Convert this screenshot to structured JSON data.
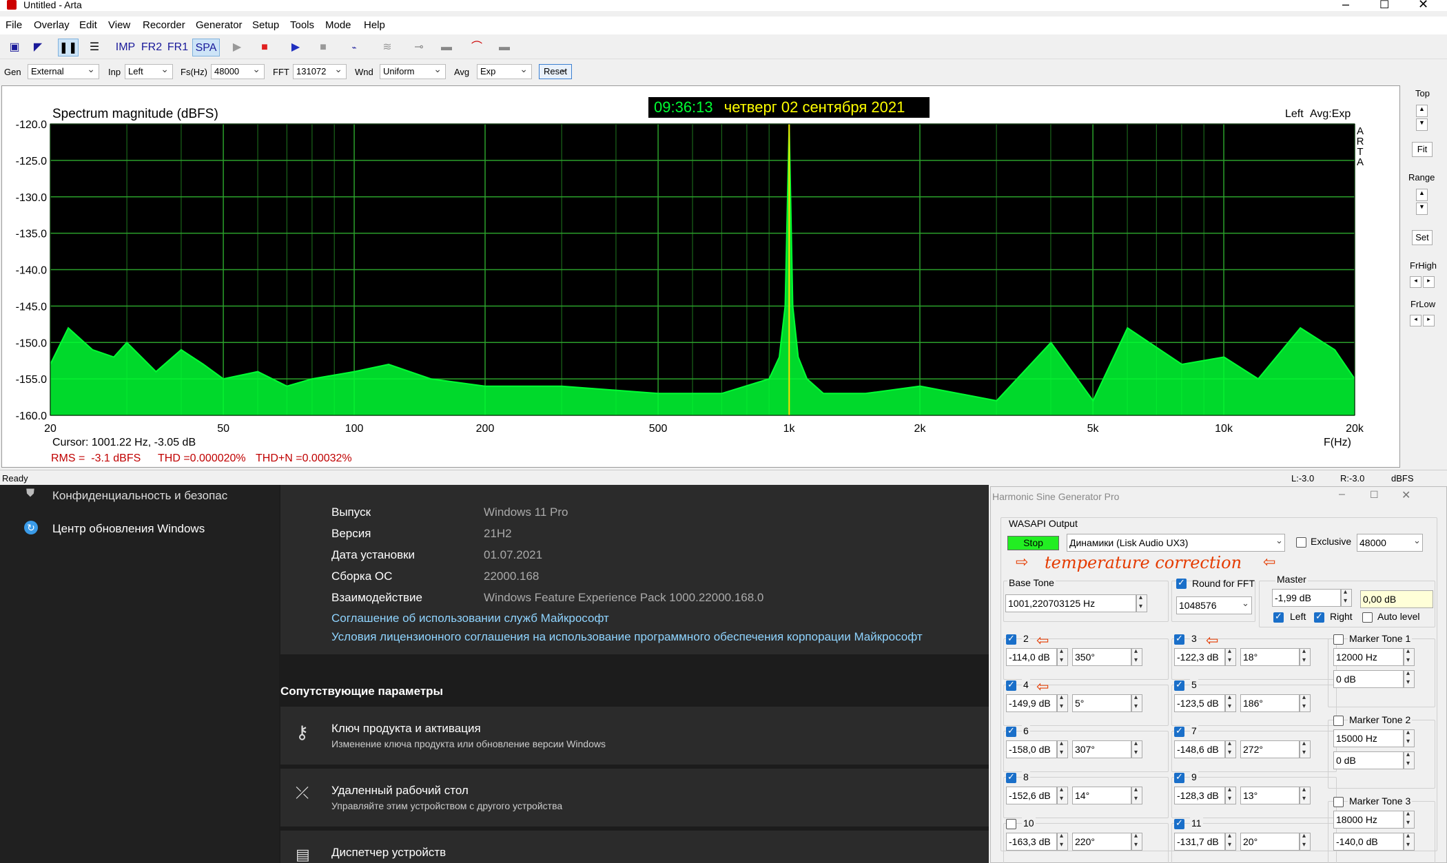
{
  "arta": {
    "title": "Untitled - Arta",
    "menu": [
      "File",
      "Overlay",
      "Edit",
      "View",
      "Recorder",
      "Generator",
      "Setup",
      "Tools",
      "Mode",
      "Help"
    ],
    "toolbar": {
      "imp": "IMP",
      "fr2": "FR2",
      "fr1": "FR1",
      "spa": "SPA"
    },
    "options": {
      "gen_label": "Gen",
      "gen_value": "External",
      "inp_label": "Inp",
      "inp_value": "Left",
      "fs_label": "Fs(Hz)",
      "fs_value": "48000",
      "fft_label": "FFT",
      "fft_value": "131072",
      "wnd_label": "Wnd",
      "wnd_value": "Uniform",
      "avg_label": "Avg",
      "avg_value": "Exp",
      "reset": "Reset"
    },
    "plot": {
      "time": "09:36:13",
      "date": "четверг 02 сентября 2021",
      "channel": "Left",
      "avg": "Avg:Exp",
      "arta_vertical": [
        "A",
        "R",
        "T",
        "A"
      ],
      "cursor": "Cursor: 1001.22 Hz, -3.05 dB",
      "rms": "RMS =  -3.1 dBFS",
      "thd": "THD =0.000020%",
      "thdn": "THD+N =0.00032%"
    },
    "right_panel": {
      "top": "Top",
      "fit": "Fit",
      "range": "Range",
      "set": "Set",
      "frhigh": "FrHigh",
      "frlow": "FrLow"
    },
    "status": {
      "ready": "Ready",
      "l": "L:-3.0",
      "r": "R:-3.0",
      "dbfs": "dBFS"
    }
  },
  "chart_data": {
    "type": "line",
    "title": "Spectrum magnitude (dBFS)",
    "xlabel": "F(Hz)",
    "ylabel": "",
    "x_scale": "log",
    "xlim": [
      20,
      20000
    ],
    "ylim": [
      -160,
      -120
    ],
    "x_ticks": [
      "20",
      "50",
      "100",
      "200",
      "500",
      "1k",
      "2k",
      "5k",
      "10k",
      "20k"
    ],
    "x_tick_values": [
      20,
      50,
      100,
      200,
      500,
      1000,
      2000,
      5000,
      10000,
      20000
    ],
    "y_ticks": [
      "-120.0",
      "-125.0",
      "-130.0",
      "-135.0",
      "-140.0",
      "-145.0",
      "-150.0",
      "-155.0",
      "-160.0"
    ],
    "y_tick_values": [
      -120,
      -125,
      -130,
      -135,
      -140,
      -145,
      -150,
      -155,
      -160
    ],
    "grid": true,
    "series": [
      {
        "color": "#00ff33",
        "x": [
          20,
          22,
          25,
          28,
          30,
          35,
          40,
          45,
          50,
          60,
          70,
          80,
          100,
          120,
          150,
          200,
          300,
          500,
          700,
          900,
          950,
          980,
          1001,
          1020,
          1050,
          1100,
          1200,
          1500,
          2002,
          3003,
          4004,
          5005,
          6006,
          8008,
          10010,
          12000,
          15000,
          18000,
          20000
        ],
        "y": [
          -153,
          -148,
          -151,
          -152,
          -150,
          -154,
          -151,
          -153,
          -155,
          -154,
          -156,
          -155,
          -154,
          -153,
          -155,
          -156,
          -156,
          -157,
          -157,
          -155,
          -152,
          -145,
          -3,
          -145,
          -152,
          -155,
          -157,
          -157,
          -156,
          -158,
          -150,
          -158,
          -148,
          -153,
          -152,
          -155,
          -148,
          -151,
          -155
        ]
      }
    ]
  },
  "winsettings": {
    "privacy": "Конфиденциальность и безопас",
    "update": "Центр обновления Windows",
    "rows": [
      {
        "k": "Выпуск",
        "v": "Windows 11 Pro"
      },
      {
        "k": "Версия",
        "v": "21H2"
      },
      {
        "k": "Дата установки",
        "v": "01.07.2021"
      },
      {
        "k": "Сборка ОС",
        "v": "22000.168"
      },
      {
        "k": "Взаимодействие",
        "v": "Windows Feature Experience Pack 1000.22000.168.0"
      }
    ],
    "link1": "Соглашение об использовании служб Майкрософт",
    "link2": "Условия лицензионного соглашения на использование программного обеспечения корпорации Майкрософт",
    "related": "Сопутствующие параметры",
    "cards": [
      {
        "title": "Ключ продукта и активация",
        "sub": "Изменение ключа продукта или обновление версии Windows"
      },
      {
        "title": "Удаленный рабочий стол",
        "sub": "Управляйте этим устройством с другого устройства"
      },
      {
        "title": "Диспетчер устройств",
        "sub": ""
      }
    ]
  },
  "hsg": {
    "title": "Harmonic Sine Generator Pro",
    "wasapi": "WASAPI Output",
    "stop": "Stop",
    "device": "Динамики (Lisk Audio UX3)",
    "exclusive": "Exclusive",
    "rate": "48000",
    "annotation": "temperature correction",
    "base_tone_label": "Base Tone",
    "base_tone": "1001,220703125 Hz",
    "round_fft": "Round for FFT",
    "fft": "1048576",
    "master_label": "Master",
    "master": "-1,99 dB",
    "master_read": "0,00 dB",
    "left": "Left",
    "right": "Right",
    "auto_level": "Auto level",
    "harmonics": [
      {
        "n": "2",
        "on": true,
        "db": "-114,0 dB",
        "ph": "350°"
      },
      {
        "n": "3",
        "on": true,
        "db": "-122,3 dB",
        "ph": "18°"
      },
      {
        "n": "4",
        "on": true,
        "db": "-149,9 dB",
        "ph": "5°"
      },
      {
        "n": "5",
        "on": true,
        "db": "-123,5 dB",
        "ph": "186°"
      },
      {
        "n": "6",
        "on": true,
        "db": "-158,0 dB",
        "ph": "307°"
      },
      {
        "n": "7",
        "on": true,
        "db": "-148,6 dB",
        "ph": "272°"
      },
      {
        "n": "8",
        "on": true,
        "db": "-152,6 dB",
        "ph": "14°"
      },
      {
        "n": "9",
        "on": true,
        "db": "-128,3 dB",
        "ph": "13°"
      },
      {
        "n": "10",
        "on": false,
        "db": "-163,3 dB",
        "ph": "220°"
      },
      {
        "n": "11",
        "on": true,
        "db": "-131,7 dB",
        "ph": "20°"
      }
    ],
    "markers": [
      {
        "label": "Marker Tone 1",
        "freq": "12000 Hz",
        "db": "0 dB"
      },
      {
        "label": "Marker Tone 2",
        "freq": "15000 Hz",
        "db": "0 dB"
      },
      {
        "label": "Marker Tone 3",
        "freq": "18000 Hz",
        "db": "-140,0 dB"
      }
    ]
  }
}
